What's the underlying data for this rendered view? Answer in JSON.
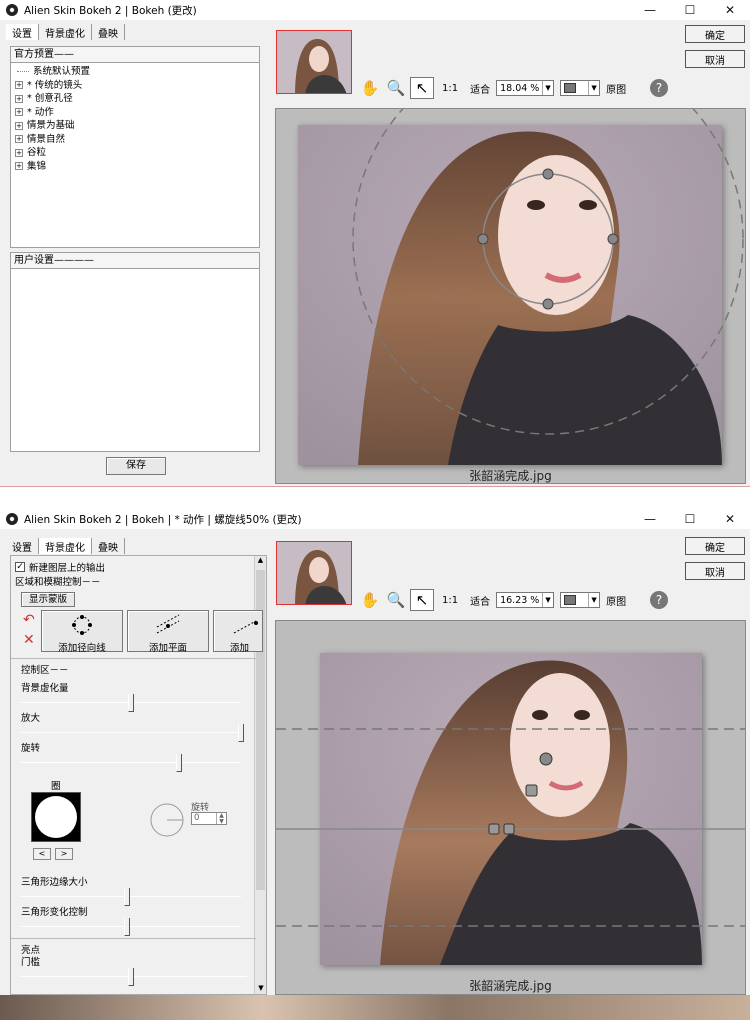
{
  "win1": {
    "title": "Alien Skin Bokeh 2 | Bokeh (更改)",
    "tabs": [
      "设置",
      "背景虚化",
      "叠映"
    ],
    "presets_header": "官方预置",
    "tree": [
      {
        "label": "系统默认预置",
        "expandable": false
      },
      {
        "label": "* 传统的镜头",
        "expandable": true
      },
      {
        "label": "* 创意孔径",
        "expandable": true
      },
      {
        "label": "* 动作",
        "expandable": true
      },
      {
        "label": "情景为基础",
        "expandable": true
      },
      {
        "label": "情景自然",
        "expandable": true
      },
      {
        "label": "谷粒",
        "expandable": true
      },
      {
        "label": "集锦",
        "expandable": true
      }
    ],
    "user_header": "用户设置",
    "save_label": "保存",
    "zoom_1to1": "1:1",
    "fit_label": "适合",
    "zoom_value": "18.04 %",
    "original_label": "原图",
    "ok_label": "确定",
    "cancel_label": "取消",
    "filename": "张韶涵完成.jpg"
  },
  "win2": {
    "title": "Alien Skin Bokeh 2 | Bokeh | * 动作 | 螺旋线50% (更改)",
    "tabs": [
      "设置",
      "背景虚化",
      "叠映"
    ],
    "new_layer_label": "新建图层上的输出",
    "region_header": "区域和模糊控制",
    "show_mask_label": "显示蒙版",
    "add_radial_label": "添加径向线",
    "add_plane_label": "添加平面",
    "add_partial_label": "添加",
    "control_header": "控制区",
    "sliders": [
      {
        "label": "背景虚化量",
        "value": 0.5
      },
      {
        "label": "放大",
        "value": 1.0
      },
      {
        "label": "旋转",
        "value": 0.72
      }
    ],
    "circle_label": "圈",
    "rotate_label": "旋转",
    "rotate_value": "0",
    "sliders2": [
      {
        "label": "三角形边缘大小",
        "value": 0.48
      },
      {
        "label": "三角形变化控制",
        "value": 0.48
      }
    ],
    "highlight_header": "亮点",
    "threshold_label": "门槛",
    "threshold_value": 0.5,
    "zoom_1to1": "1:1",
    "fit_label": "适合",
    "zoom_value": "16.23 %",
    "original_label": "原图",
    "ok_label": "确定",
    "cancel_label": "取消",
    "filename": "张韶涵完成.jpg"
  },
  "colors": {
    "window_bg": "#f0f0f0",
    "preview_bg": "#bcbcbc",
    "photo_bg": "#aea1ae",
    "thumb_border": "#dd3333"
  },
  "icons": [
    "hand-icon",
    "magnifier-icon",
    "pointer-icon",
    "help-icon",
    "undo-icon",
    "delete-icon",
    "radial-icon",
    "plane-icon"
  ]
}
